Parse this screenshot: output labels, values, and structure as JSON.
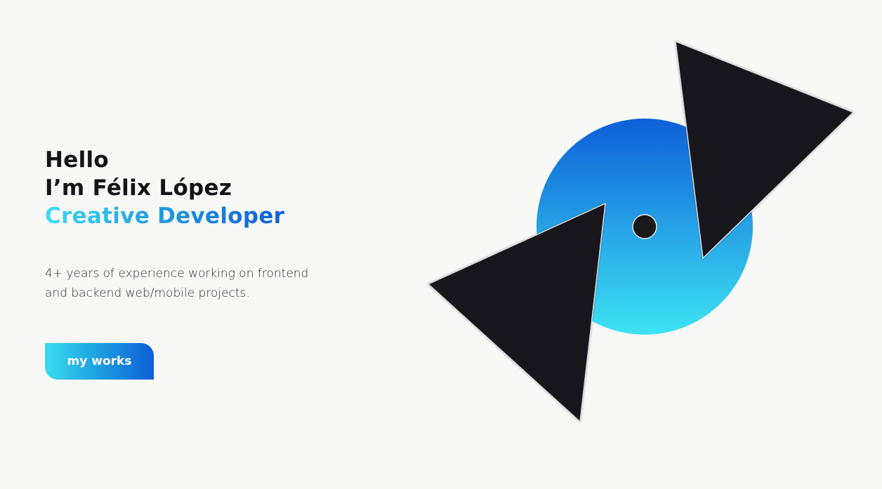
{
  "hero": {
    "greeting": "Hello",
    "name_line": "I’m Félix López",
    "role": "Creative Developer",
    "description_line1": "4+ years of experience working on frontend",
    "description_line2": "and backend web/mobile projects."
  },
  "cta": {
    "label": "my works"
  },
  "colors": {
    "background": "#f8f8f7",
    "text_dark": "#151517",
    "gradient_light": "#3adcf0",
    "gradient_dark": "#0d5fd7",
    "triangle": "#19191b"
  }
}
